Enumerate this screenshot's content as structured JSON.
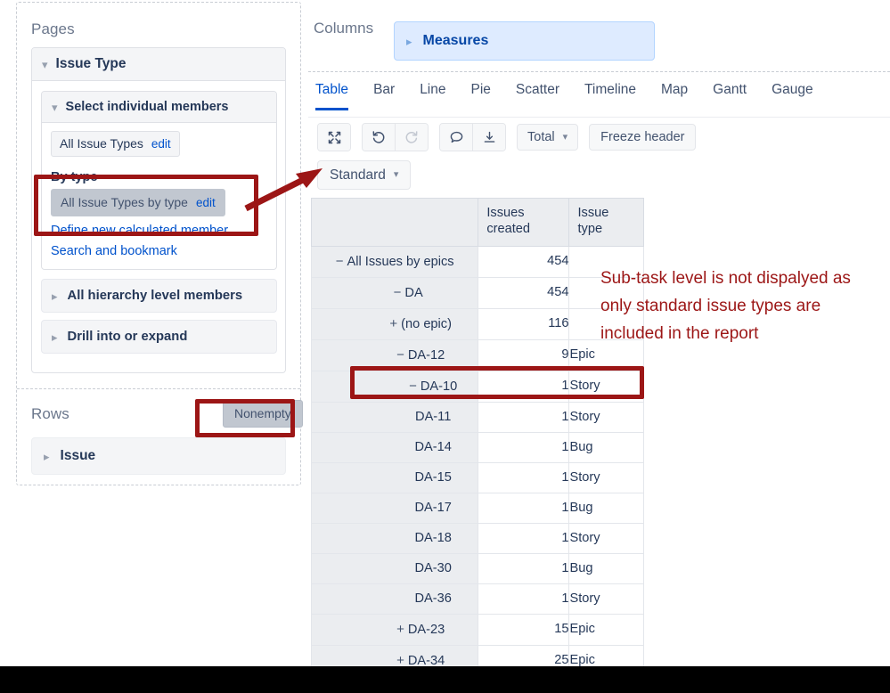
{
  "left_panel": {
    "pages_title": "Pages",
    "rows_title": "Rows",
    "issue_type_card": {
      "header": "Issue Type",
      "select_members": {
        "header": "Select individual members",
        "chip_all": {
          "label": "All Issue Types",
          "edit": "edit"
        },
        "by_type_label": "By type",
        "chip_by_type": {
          "label": "All Issue Types by type",
          "edit": "edit"
        },
        "links": [
          "Define new calculated member",
          "Search and bookmark"
        ]
      },
      "collapsed_bars": [
        "All hierarchy level members",
        "Drill into or expand"
      ]
    },
    "rows": {
      "nonempty_button": "Nonempty",
      "issue_bar": "Issue"
    }
  },
  "right_panel": {
    "columns_label": "Columns",
    "measures_box": "Measures",
    "tabs": [
      {
        "label": "Table",
        "active": true
      },
      {
        "label": "Bar",
        "active": false
      },
      {
        "label": "Line",
        "active": false
      },
      {
        "label": "Pie",
        "active": false
      },
      {
        "label": "Scatter",
        "active": false
      },
      {
        "label": "Timeline",
        "active": false
      },
      {
        "label": "Map",
        "active": false
      },
      {
        "label": "Gantt",
        "active": false
      },
      {
        "label": "Gauge",
        "active": false
      }
    ],
    "toolbar": {
      "icons": [
        "expand-icon",
        "undo-icon",
        "redo-icon",
        "comment-icon",
        "download-icon"
      ],
      "total_dropdown": "Total",
      "freeze_header_button": "Freeze header",
      "standard_dropdown": "Standard"
    }
  },
  "chart_data": {
    "type": "table",
    "title": "",
    "columns": [
      "",
      "Issues created",
      "Issue type"
    ],
    "rows": [
      {
        "toggle": "−",
        "indent": 0,
        "label": "All Issues by epics",
        "issues_created": "454",
        "issue_type": ""
      },
      {
        "toggle": "−",
        "indent": 1,
        "label": "DA",
        "issues_created": "454",
        "issue_type": ""
      },
      {
        "toggle": "+",
        "indent": 2,
        "label": "(no epic)",
        "issues_created": "116",
        "issue_type": ""
      },
      {
        "toggle": "−",
        "indent": 2,
        "label": "DA-12",
        "issues_created": "9",
        "issue_type": "Epic"
      },
      {
        "toggle": "−",
        "indent": 3,
        "label": "DA-10",
        "issues_created": "1",
        "issue_type": "Story"
      },
      {
        "toggle": "",
        "indent": 3,
        "label": "DA-11",
        "issues_created": "1",
        "issue_type": "Story"
      },
      {
        "toggle": "",
        "indent": 3,
        "label": "DA-14",
        "issues_created": "1",
        "issue_type": "Bug"
      },
      {
        "toggle": "",
        "indent": 3,
        "label": "DA-15",
        "issues_created": "1",
        "issue_type": "Story"
      },
      {
        "toggle": "",
        "indent": 3,
        "label": "DA-17",
        "issues_created": "1",
        "issue_type": "Bug"
      },
      {
        "toggle": "",
        "indent": 3,
        "label": "DA-18",
        "issues_created": "1",
        "issue_type": "Story"
      },
      {
        "toggle": "",
        "indent": 3,
        "label": "DA-30",
        "issues_created": "1",
        "issue_type": "Bug"
      },
      {
        "toggle": "",
        "indent": 3,
        "label": "DA-36",
        "issues_created": "1",
        "issue_type": "Story"
      },
      {
        "toggle": "+",
        "indent": 2,
        "label": "DA-23",
        "issues_created": "15",
        "issue_type": "Epic"
      },
      {
        "toggle": "+",
        "indent": 2,
        "label": "DA-34",
        "issues_created": "25",
        "issue_type": "Epic"
      }
    ]
  },
  "annotations": {
    "note_text": "Sub-task level is not dispalyed as only standard issue types are included in the report",
    "highlight_color": "#9c1616"
  }
}
